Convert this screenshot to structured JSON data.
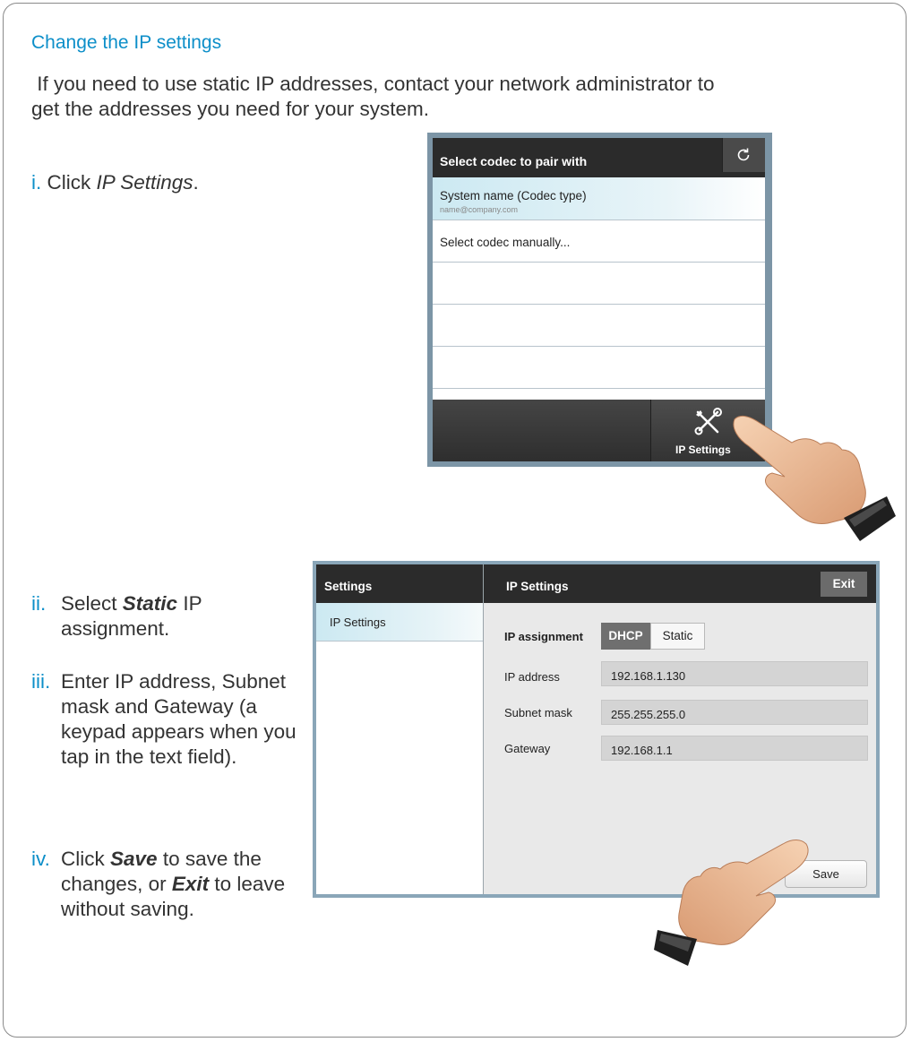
{
  "heading": "Change the IP settings",
  "intro": " If you need to use static IP addresses, contact your network administrator to get the addresses you need for your system.",
  "steps": {
    "i": {
      "num": "i.",
      "pre": "Click ",
      "em": "IP Settings",
      "post": "."
    },
    "ii": {
      "num": "ii.",
      "pre": "Select ",
      "em": "Static",
      "post": " IP assignment."
    },
    "iii": {
      "num": "iii.",
      "text": "Enter IP address, Subnet mask and Gateway (a keypad appears when you tap in the text field)."
    },
    "iv": {
      "num": "iv.",
      "pre": "Click ",
      "em1": "Save",
      "mid": " to save the changes, or ",
      "em2": "Exit",
      "post": " to leave without saving."
    }
  },
  "screen1": {
    "title": "Select codec to pair with",
    "refresh_icon": "refresh-icon",
    "selected_item": {
      "name": "System name (Codec type)",
      "address": "name@company.com"
    },
    "manual_item": "Select codec manually...",
    "ip_button": {
      "label": "IP Settings",
      "icon": "wrench-screwdriver-icon"
    }
  },
  "screen2": {
    "left_title": "Settings",
    "right_title": "IP Settings",
    "exit_label": "Exit",
    "nav_selected": "IP Settings",
    "ip_assignment_label": "IP assignment",
    "dhcp_label": "DHCP",
    "static_label": "Static",
    "fields": {
      "ip_address": {
        "label": "IP address",
        "value": "192.168.1.130"
      },
      "subnet_mask": {
        "label": "Subnet mask",
        "value": "255.255.255.0"
      },
      "gateway": {
        "label": "Gateway",
        "value": "192.168.1.1"
      }
    },
    "save_label": "Save"
  },
  "colors": {
    "accent": "#0d8fc9",
    "header": "#2b2b2b",
    "selection": "#cce9f2"
  }
}
